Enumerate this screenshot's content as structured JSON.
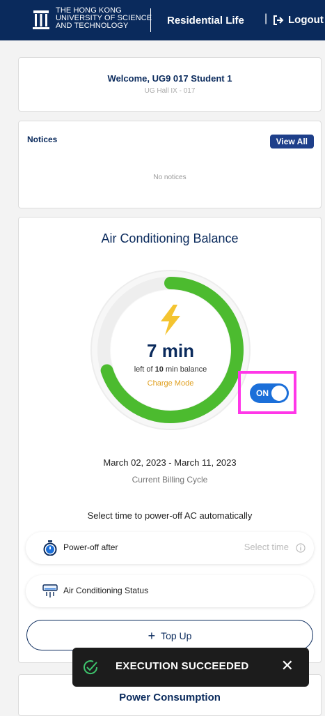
{
  "header": {
    "university_lines": [
      "THE HONG KONG",
      "UNIVERSITY OF SCIENCE",
      "AND TECHNOLOGY"
    ],
    "title": "Residential Life",
    "separator": "|",
    "logout_label": "Logout"
  },
  "welcome": {
    "title": "Welcome, UG9 017 Student 1",
    "subtitle": "UG Hall IX - 017"
  },
  "notices": {
    "title": "Notices",
    "view_all_label": "View All",
    "empty_text": "No notices"
  },
  "ac": {
    "title": "Air Conditioning Balance",
    "remaining_value": "7",
    "remaining_unit": "min",
    "left_of_prefix": "left of",
    "total_value": "10",
    "left_of_suffix": "min balance",
    "remaining_fraction": 0.7,
    "mode_label": "Charge Mode",
    "billing_dates": "March 02, 2023 - March 11, 2023",
    "billing_label": "Current Billing Cycle",
    "select_prompt": "Select time to power-off AC automatically",
    "power_off_label": "Power-off after",
    "select_time_placeholder": "Select time",
    "status_label": "Air Conditioning Status",
    "toggle_label": "ON",
    "toggle_on": true,
    "topup_label": "Top Up"
  },
  "power": {
    "title": "Power Consumption"
  },
  "toast": {
    "message": "EXECUTION SUCCEEDED",
    "close_glyph": "✕"
  },
  "colors": {
    "navy": "#0a2a5c",
    "gauge_green": "#4cbb2f",
    "gauge_track": "#eeeeee",
    "bolt_yellow": "#f4c430",
    "charge_mode": "#e0a020",
    "toggle_blue": "#1b6fd9",
    "highlight_magenta": "#ff37e8",
    "toast_bg": "#1c1c1c",
    "toast_check": "#3ec46d"
  },
  "icons": {
    "logo": "hkust-logo-icon",
    "logout": "logout-arrow-icon",
    "bolt": "lightning-bolt-icon",
    "timer": "stopwatch-icon",
    "ac_unit": "air-conditioner-icon",
    "info": "info-icon",
    "plus": "plus-icon",
    "check": "check-circle-icon",
    "close": "close-icon"
  }
}
